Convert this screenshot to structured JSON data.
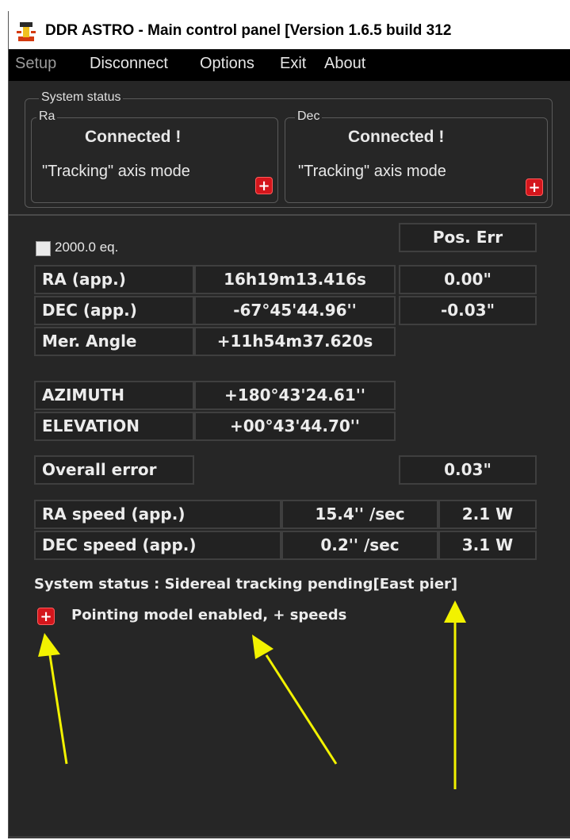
{
  "window": {
    "title": "DDR ASTRO - Main control panel  [Version  1.6.5 build 312",
    "app_icon": "telescope-icon"
  },
  "menu": {
    "items": [
      {
        "label": "Setup"
      },
      {
        "label": "Disconnect"
      },
      {
        "label": "Options"
      },
      {
        "label": "Exit"
      },
      {
        "label": "About"
      }
    ]
  },
  "system_status_group": {
    "title": "System status",
    "ra": {
      "title": "Ra",
      "state": "Connected !",
      "mode": "\"Tracking\" axis mode",
      "button_icon": "plus-icon"
    },
    "dec": {
      "title": "Dec",
      "state": "Connected !",
      "mode": "\"Tracking\" axis mode",
      "button_icon": "plus-icon"
    }
  },
  "coords": {
    "eq2000_label": "2000.0 eq.",
    "eq2000_checked": false,
    "pos_err_header": "Pos. Err",
    "rows": [
      {
        "label": "RA (app.)",
        "value": "16h19m13.416s",
        "err": "0.00\""
      },
      {
        "label": "DEC (app.)",
        "value": "-67°45'44.96''",
        "err": "-0.03\""
      },
      {
        "label": "Mer. Angle",
        "value": "+11h54m37.620s",
        "err": ""
      }
    ]
  },
  "altaz": {
    "rows": [
      {
        "label": "AZIMUTH",
        "value": "+180°43'24.61''"
      },
      {
        "label": "ELEVATION",
        "value": "+00°43'44.70''"
      }
    ]
  },
  "overall": {
    "label": "Overall error",
    "value": "0.03\""
  },
  "speeds": {
    "rows": [
      {
        "label": "RA speed (app.)",
        "speed": "15.4'' /sec",
        "power": "2.1 W"
      },
      {
        "label": "DEC speed (app.)",
        "speed": "0.2'' /sec",
        "power": "3.1 W"
      }
    ]
  },
  "footer": {
    "system_status": "System status : Sidereal tracking pending[East pier]",
    "pointing_model": "Pointing model enabled, + speeds",
    "pointing_button_icon": "plus-icon"
  },
  "colors": {
    "background": "#262626",
    "accent_red": "#d4161c",
    "annotation_arrow": "#f2f200"
  }
}
